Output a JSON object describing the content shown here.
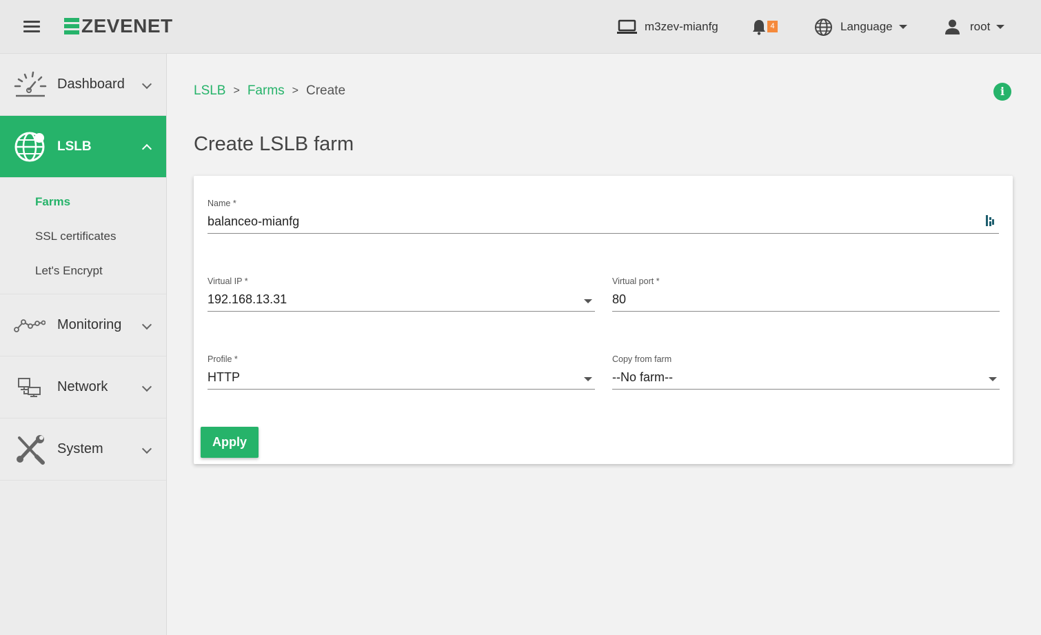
{
  "topbar": {
    "brand": "ZEVENET",
    "hostname": "m3zev-mianfg",
    "notifications_count": "4",
    "language_label": "Language",
    "user_label": "root"
  },
  "sidebar": {
    "items": [
      {
        "label": "Dashboard",
        "icon": "dashboard-gauge-icon"
      },
      {
        "label": "LSLB",
        "icon": "globe-icon",
        "active": true
      },
      {
        "label": "Monitoring",
        "icon": "monitoring-graph-icon"
      },
      {
        "label": "Network",
        "icon": "network-computers-icon"
      },
      {
        "label": "System",
        "icon": "wrench-screwdriver-icon"
      }
    ],
    "lslb_sub": [
      {
        "label": "Farms",
        "active": true
      },
      {
        "label": "SSL certificates"
      },
      {
        "label": "Let's Encrypt"
      }
    ]
  },
  "breadcrumb": {
    "items": [
      "LSLB",
      "Farms",
      "Create"
    ],
    "separator": ">"
  },
  "page": {
    "title": "Create LSLB farm"
  },
  "form": {
    "name": {
      "label": "Name *",
      "value": "balanceo-mianfg"
    },
    "virtual_ip": {
      "label": "Virtual IP *",
      "value": "192.168.13.31"
    },
    "virtual_port": {
      "label": "Virtual port *",
      "value": "80"
    },
    "profile": {
      "label": "Profile *",
      "value": "HTTP"
    },
    "copy_from": {
      "label": "Copy from farm",
      "value": "--No farm--"
    },
    "apply_label": "Apply"
  },
  "colors": {
    "accent": "#26b36a",
    "badge": "#f58a3c"
  }
}
